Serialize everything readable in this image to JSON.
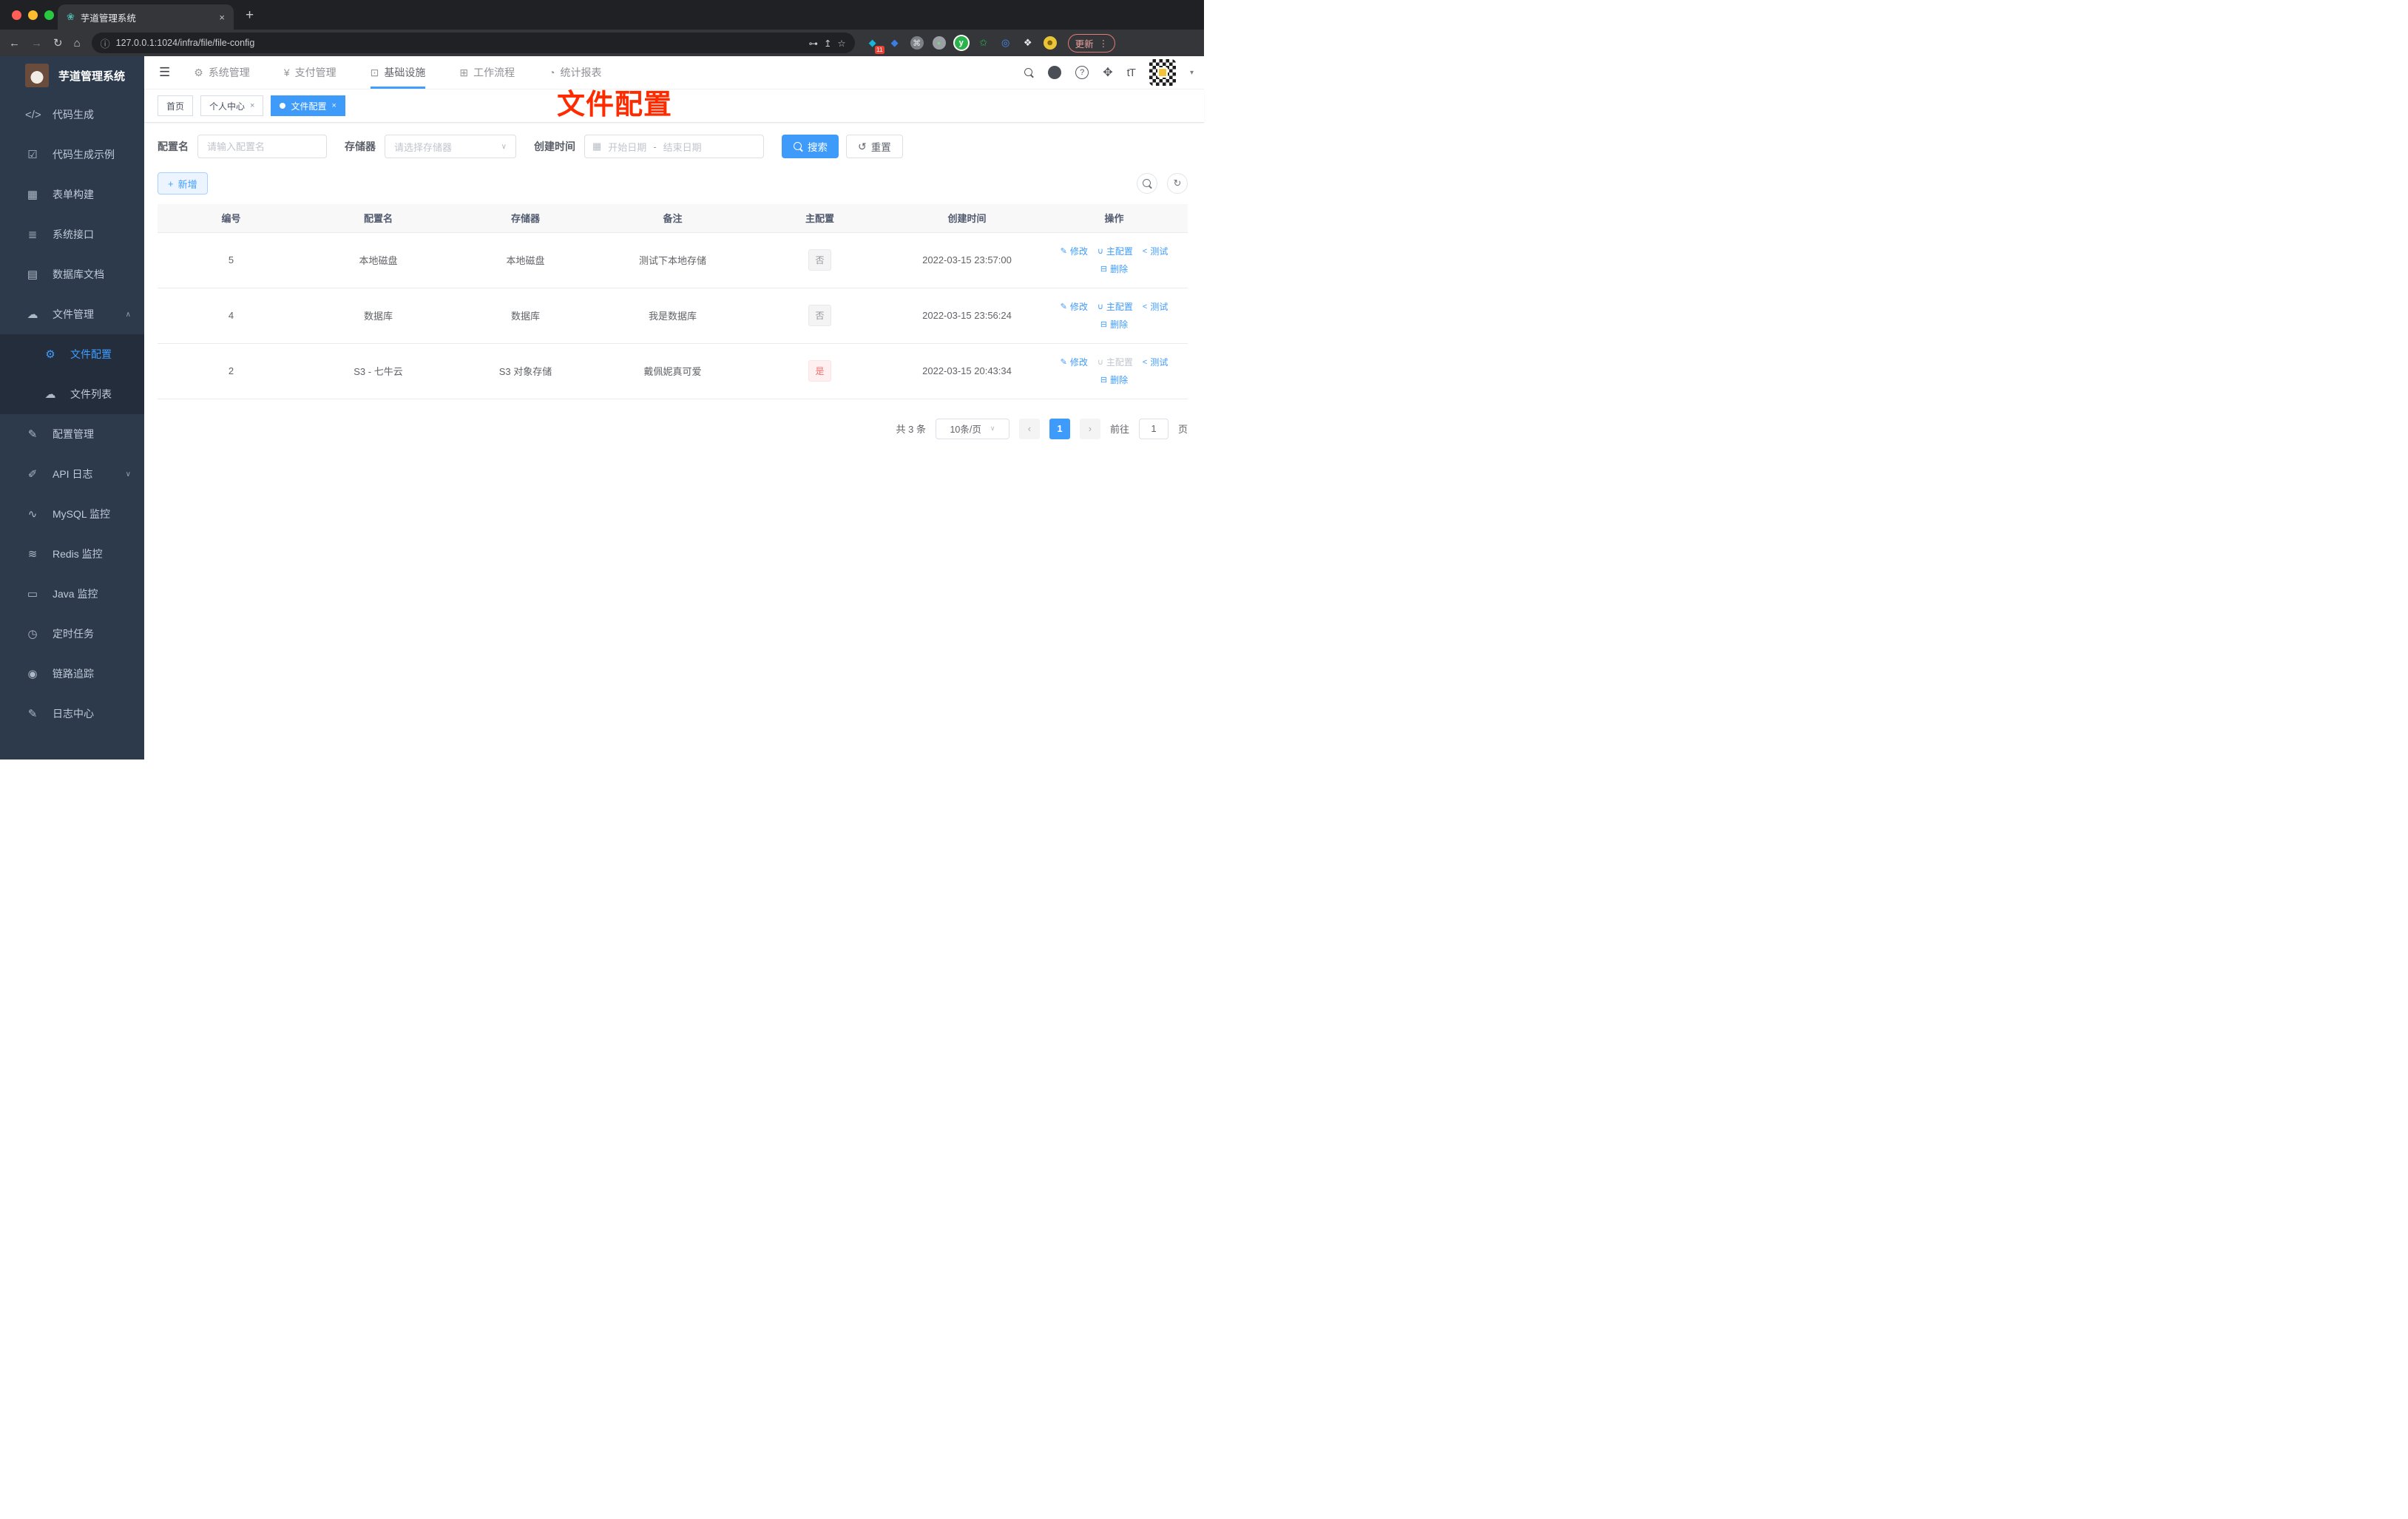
{
  "browser": {
    "tab_title": "芋道管理系统",
    "tab_close": "×",
    "new_tab": "+",
    "url_info": "ⓘ",
    "url": "127.0.0.1:1024/infra/file/file-config",
    "ext_badge": "11",
    "update_label": "更新",
    "menu_dots": "⋮",
    "extensions": [
      "◆",
      "◆",
      "⌘",
      "●",
      "y",
      "✩",
      "◎",
      "❖",
      "☻"
    ]
  },
  "sidebar": {
    "logo_title": "芋道管理系统",
    "items": [
      {
        "label": "代码生成",
        "glyph": "</>"
      },
      {
        "label": "代码生成示例",
        "glyph": "☑"
      },
      {
        "label": "表单构建",
        "glyph": "▦"
      },
      {
        "label": "系统接口",
        "glyph": "≣"
      },
      {
        "label": "数据库文档",
        "glyph": "▤"
      },
      {
        "label": "文件管理",
        "glyph": "☁",
        "chevron": "∧"
      },
      {
        "label": "文件配置",
        "glyph": "⚙"
      },
      {
        "label": "文件列表",
        "glyph": "☁"
      },
      {
        "label": "配置管理",
        "glyph": "✎"
      },
      {
        "label": "API 日志",
        "glyph": "✐",
        "chevron": "∨"
      },
      {
        "label": "MySQL 监控",
        "glyph": "∿"
      },
      {
        "label": "Redis 监控",
        "glyph": "≋"
      },
      {
        "label": "Java 监控",
        "glyph": "▭"
      },
      {
        "label": "定时任务",
        "glyph": "◷"
      },
      {
        "label": "链路追踪",
        "glyph": "◉"
      },
      {
        "label": "日志中心",
        "glyph": "✎"
      }
    ]
  },
  "topnav": {
    "items": [
      {
        "label": "系统管理",
        "glyph": "⚙"
      },
      {
        "label": "支付管理",
        "glyph": "¥"
      },
      {
        "label": "基础设施",
        "glyph": "⊡"
      },
      {
        "label": "工作流程",
        "glyph": "⊞"
      },
      {
        "label": "统计报表",
        "glyph": "◔"
      }
    ],
    "fontsize_icon": "tT",
    "caret": "▾"
  },
  "tags": {
    "home": "首页",
    "profile": "个人中心",
    "current": "文件配置",
    "close": "×"
  },
  "annotation": {
    "text": "文件配置",
    "color": "#ff2b00"
  },
  "filters": {
    "name_label": "配置名",
    "name_placeholder": "请输入配置名",
    "storage_label": "存储器",
    "storage_placeholder": "请选择存储器",
    "storage_chevron": "∨",
    "time_label": "创建时间",
    "calendar_icon": "▦",
    "start_placeholder": "开始日期",
    "range_separator": "-",
    "end_placeholder": "结束日期",
    "search_label": "搜索",
    "reset_label": "重置",
    "reset_icon": "↺"
  },
  "toolbar": {
    "add_plus": "+",
    "add_label": "新增",
    "refresh_icon": "↻"
  },
  "table": {
    "headers": [
      "编号",
      "配置名",
      "存储器",
      "备注",
      "主配置",
      "创建时间",
      "操作"
    ],
    "actions": {
      "edit": "修改",
      "master": "主配置",
      "test": "测试",
      "delete": "删除"
    },
    "action_icons": {
      "edit": "✎",
      "master": "∪",
      "test": "<",
      "delete": "⊟"
    },
    "rows": [
      {
        "id": "5",
        "name": "本地磁盘",
        "storage": "本地磁盘",
        "remark": "测试下本地存储",
        "master": "否",
        "created": "2022-03-15 23:57:00"
      },
      {
        "id": "4",
        "name": "数据库",
        "storage": "数据库",
        "remark": "我是数据库",
        "master": "否",
        "created": "2022-03-15 23:56:24"
      },
      {
        "id": "2",
        "name": "S3 - 七牛云",
        "storage": "S3 对象存储",
        "remark": "戴佩妮真可爱",
        "master": "是",
        "created": "2022-03-15 20:43:34"
      }
    ]
  },
  "pagination": {
    "total": "共 3 条",
    "page_size": "10条/页",
    "chevron": "∨",
    "prev": "‹",
    "current": "1",
    "next": "›",
    "goto_label": "前往",
    "goto_value": "1",
    "unit": "页"
  },
  "colors": {
    "accent": "#409eff",
    "danger": "#f56c6c",
    "info": "#909399",
    "annotation": "#ff2b00"
  }
}
